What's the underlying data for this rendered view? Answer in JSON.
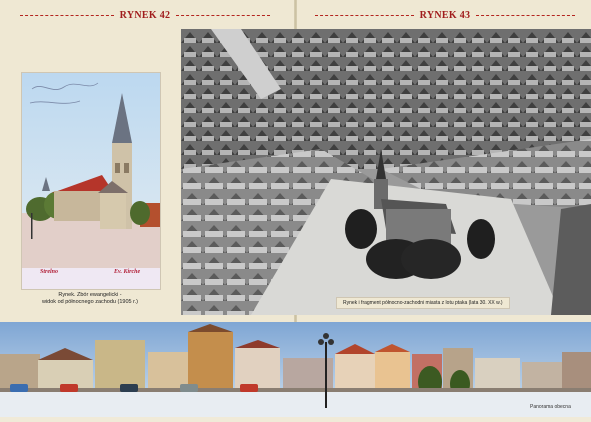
{
  "pages": {
    "left": {
      "page_label": "RYNEK 42"
    },
    "right": {
      "page_label": "RYNEK 43"
    }
  },
  "postcard": {
    "caption_left": "Strelno",
    "caption_right": "Ev. Kirche"
  },
  "left_caption": {
    "line1": "Rynek. Zbór ewangelicki -",
    "line2": "widok od północnego zachodu (1905 r.)"
  },
  "aerial_caption": "Rynek i fragment północno-zachodni miasta z lotu ptaka (lata 30. XX w.)",
  "panorama_caption": "Panorama obecna"
}
